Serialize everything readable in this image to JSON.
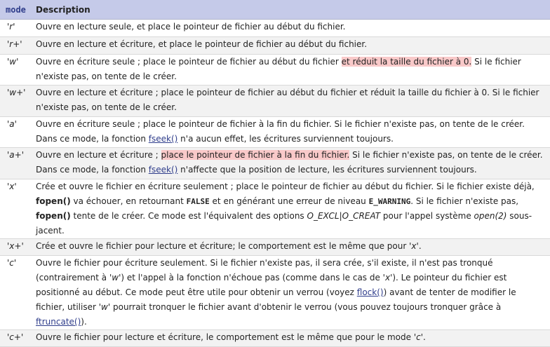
{
  "header": {
    "mode": "mode",
    "description": "Description"
  },
  "rows": [
    {
      "mode": "'r'",
      "p": [
        "Ouvre en lecture seule, et place le pointeur de fichier au début du fichier."
      ]
    },
    {
      "mode": "'r+'",
      "p": [
        "Ouvre en lecture et écriture, et place le pointeur de fichier au début du fichier."
      ]
    },
    {
      "mode": "'w'",
      "p": [
        "Ouvre en écriture seule ; place le pointeur de fichier au début du fichier ",
        "et réduit la taille du fichier à 0.",
        " Si le fichier n'existe pas, on tente de le créer."
      ]
    },
    {
      "mode": "'w+'",
      "p": [
        "Ouvre en lecture et écriture ; place le pointeur de fichier au début du fichier et réduit la taille du fichier à 0. Si le fichier n'existe pas, on tente de le créer."
      ]
    },
    {
      "mode": "'a'",
      "p": [
        "Ouvre en écriture seule ; place le pointeur de fichier à la fin du fichier. Si le fichier n'existe pas, on tente de le créer. Dans ce mode, la fonction ",
        "fseek()",
        " n'a aucun effet, les écritures surviennent toujours."
      ]
    },
    {
      "mode": "'a+'",
      "p": [
        "Ouvre en lecture et écriture ; ",
        "place le pointeur de fichier à la fin du fichier.",
        " Si le fichier n'existe pas, on tente de le créer. Dans ce mode, la fonction ",
        "fseek()",
        " n'affecte que la position de lecture, les écritures surviennent toujours."
      ]
    },
    {
      "mode": "'x'",
      "p": [
        "Crée et ouvre le fichier en écriture seulement ; place le pointeur de fichier au début du fichier. Si le fichier existe déjà, ",
        "fopen()",
        " va échouer, en retournant ",
        "FALSE",
        " et en générant une erreur de niveau ",
        "E_WARNING",
        ". Si le fichier n'existe pas, ",
        "fopen()",
        " tente de le créer. Ce mode est l'équivalent des options ",
        "O_EXCL|O_CREAT",
        " pour l'appel système ",
        "open(2)",
        " sous-jacent."
      ]
    },
    {
      "mode": "'x+'",
      "p": [
        "Crée et ouvre le fichier pour lecture et écriture; le comportement est le même que pour ",
        "'x'",
        "."
      ]
    },
    {
      "mode": "'c'",
      "p": [
        "Ouvre le fichier pour écriture seulement. Si le fichier n'existe pas, il sera crée, s'il existe, il n'est pas tronqué (contrairement à ",
        "'w'",
        ") et l'appel à la fonction n'échoue pas (comme dans le cas de ",
        "'x'",
        "). Le pointeur du fichier est positionné au début. Ce mode peut être utile pour obtenir un verrou (voyez ",
        "flock()",
        ") avant de tenter de modifier le fichier, utiliser ",
        "'w'",
        " pourrait tronquer le fichier avant d'obtenir le verrou (vous pouvez toujours tronquer grâce à ",
        "ftruncate()",
        ")."
      ]
    },
    {
      "mode": "'c+'",
      "p": [
        "Ouvre le fichier pour lecture et écriture, le comportement est le même que pour le mode ",
        "'c'",
        "."
      ]
    }
  ]
}
